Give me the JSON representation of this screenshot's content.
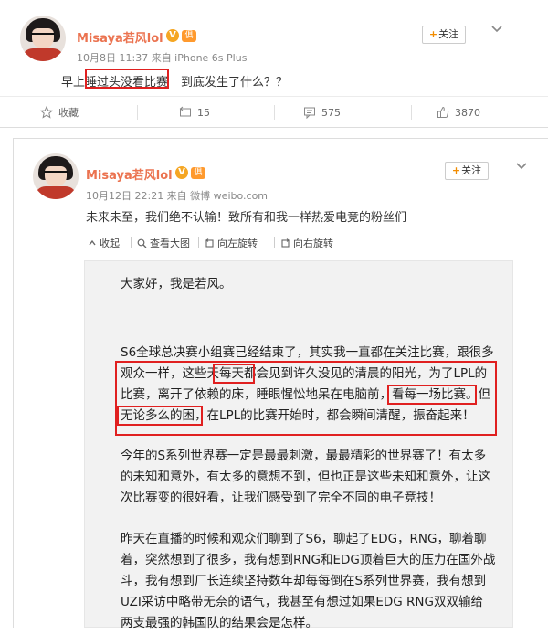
{
  "post1": {
    "username": "Misaya若风lol",
    "verified_badge": "V",
    "club_badge": "俱",
    "meta": "10月8日 11:37 来自 iPhone 6s Plus",
    "follow_label": "关注",
    "text_before": "早上",
    "text_boxed": "睡过头没看比赛",
    "text_after": "到底发生了什么？？",
    "actions": {
      "favorite_label": "收藏",
      "repost_count": "15",
      "comment_count": "575",
      "like_count": "3870"
    }
  },
  "post2": {
    "username": "Misaya若风lol",
    "verified_badge": "V",
    "club_badge": "俱",
    "meta": "10月12日 22:21 来自 微博 weibo.com",
    "follow_label": "关注",
    "text": "未来未至，我们绝不认输！致所有和我一样热爱电竞的粉丝们",
    "toolbar": {
      "collapse": "收起",
      "view_large": "查看大图",
      "rotate_left": "向左旋转",
      "rotate_right": "向右旋转"
    },
    "article": {
      "greeting": "大家好，我是若风。",
      "p1": [
        "S6全球总决赛小组赛已经结束了，其实我一直都在关注比赛，跟很多",
        "观众一样，这些天每天都会见到许久没见的清晨的阳光，为了LPL的",
        "比赛，离开了依赖的床，睡眼惺忪地呆在电脑前，看每一场比赛。但",
        "无论多么的困，在LPL的比赛开始时，都会瞬间清醒，振奋起来！"
      ],
      "p2": [
        "今年的S系列世界赛一定是最最刺激，最最精彩的世界赛了！有太多",
        "的未知和意外，有太多的意想不到，但也正是这些未知和意外，让这",
        "次比赛变的很好看，让我们感受到了完全不同的电子竞技！"
      ],
      "p3": [
        "昨天在直播的时候和观众们聊到了S6，聊起了EDG，RNG，聊着聊",
        "着，突然想到了很多，我有想到RNG和EDG顶着巨大的压力在国外战",
        "斗，我有想到厂长连续坚持数年却每每倒在S系列世界赛，我有想到",
        "UZI采访中略带无奈的语气，我甚至有想过如果EDG RNG双双输给",
        "两支最强的韩国队的结果会是怎样。"
      ]
    }
  },
  "colors": {
    "username": "#eb7350",
    "highlight_box": "#e02020",
    "follow_plus": "#f28c00"
  }
}
